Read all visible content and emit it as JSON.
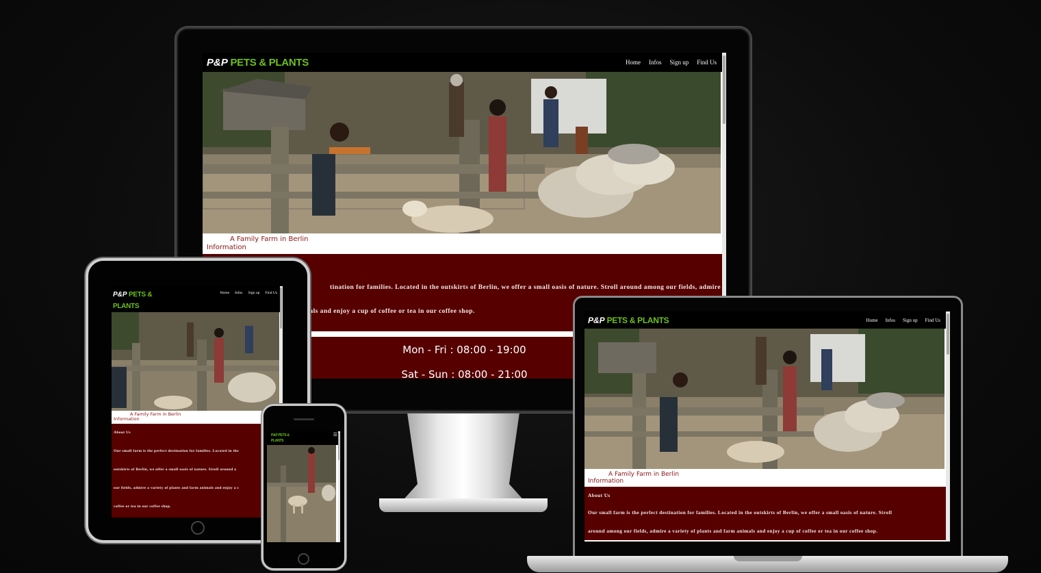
{
  "site": {
    "logo_prefix": "P&P",
    "logo_brand": "PETS & PLANTS",
    "nav": [
      "Home",
      "Infos",
      "Sign up",
      "Find Us"
    ],
    "tagline": "A Family Farm in Berlin",
    "info_label": "Information",
    "about_title": "About Us",
    "about_text": "Our small farm is the perfect destination for families. Located in the outskirts of Berlin, we offer a small oasis of nature. Stroll around among our fields, admire a variety of plants and farm animals and enjoy a cup of coffee or tea in our coffee shop.",
    "monitor_about_line1": "tination for families. Located in the outskirts of Berlin, we offer a small oasis of nature. Stroll around among our fields, admire",
    "monitor_about_line2": "mals and enjoy a cup of coffee or tea in our coffee shop.",
    "hours_weekday": "Mon - Fri : 08:00 - 19:00",
    "hours_weekend": "Sat - Sun : 08:00 - 21:00",
    "tablet_about_lines": [
      "Our small farm is the perfect destination for families. Located in the",
      "outskirts of Berlin, we offer a small oasis of nature. Stroll around a",
      "our fields, admire a variety of plants and farm animals and enjoy a c",
      "coffee or tea in our coffee shop."
    ],
    "laptop_about_lines": [
      "Our small farm is the perfect destination for families. Located in the outskirts of Berlin, we offer a small oasis of nature. Stroll",
      "around among our fields, admire a variety of plants and farm animals and enjoy a cup of coffee or tea in our coffee shop."
    ],
    "phone_logo_line1": "P&P PETS &",
    "phone_logo_line2": "PLANTS",
    "tablet_logo_line2": "PLANTS"
  },
  "colors": {
    "brand_green": "#6cc21c",
    "nav_bg": "#000000",
    "section_bg": "#560000",
    "tagline_color": "#8b1212",
    "backdrop": "#0c0c0c"
  },
  "icons": [
    "hamburger-menu-icon"
  ]
}
